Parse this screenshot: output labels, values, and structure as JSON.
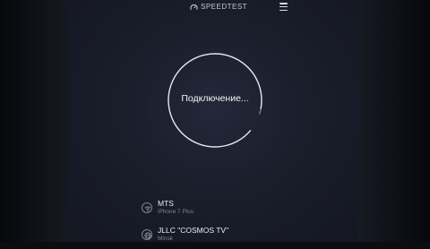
{
  "header": {
    "logo_icon": "speedtest-gauge-icon",
    "logo_text": "SPEEDTEST",
    "menu_icon": "menu-icon"
  },
  "status": {
    "text": "Подключение..."
  },
  "provider": {
    "icon": "wifi-icon",
    "name": "MTS",
    "device": "iPhone 7 Plus"
  },
  "server": {
    "icon": "globe-icon",
    "name": "JLLC \"COSMOS TV\"",
    "city": "Minsk"
  },
  "colors": {
    "background": "#1a1e2b",
    "ring": "#e6e9ee",
    "accent": "#c7ccd6"
  }
}
